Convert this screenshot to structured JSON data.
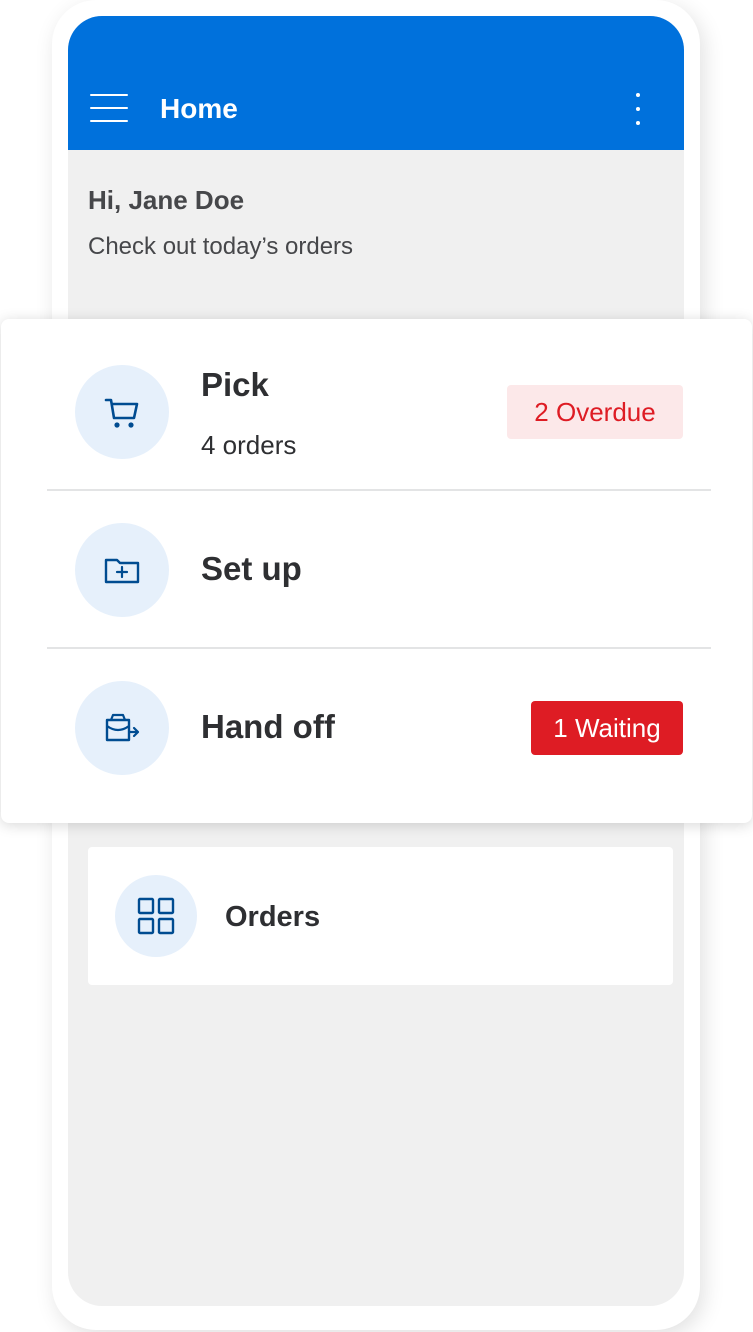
{
  "app_bar": {
    "title": "Home",
    "menu_icon": "hamburger-menu-icon",
    "more_icon": "more-vertical-icon",
    "color": "#0071dc"
  },
  "greeting": {
    "title": "Hi, Jane Doe",
    "subtitle": "Check out today’s orders"
  },
  "tasks": {
    "pick": {
      "label": "Pick",
      "subtitle": "4 orders",
      "badge": "2 Overdue",
      "icon": "cart-icon"
    },
    "setup": {
      "label": "Set up",
      "icon": "folder-plus-icon"
    },
    "handoff": {
      "label": "Hand off",
      "badge": "1 Waiting",
      "icon": "bag-handoff-icon"
    }
  },
  "orders": {
    "label": "Orders",
    "icon": "grid-icon"
  },
  "colors": {
    "accent": "#0071dc",
    "alert_red": "#de1c24",
    "alert_red_light": "#fce8e9",
    "icon_bg": "#e6f0fb"
  }
}
